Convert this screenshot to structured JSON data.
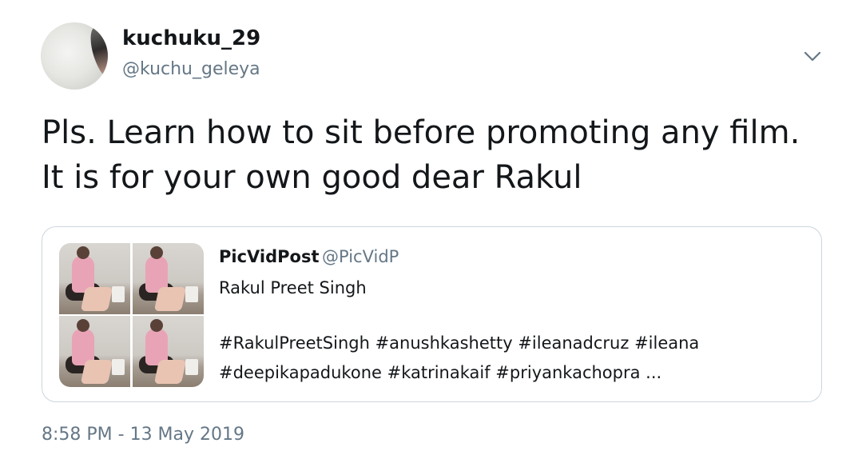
{
  "tweet": {
    "display_name": "kuchuku_29",
    "handle": "@kuchu_geleya",
    "text": "Pls. Learn how to sit before promoting any film. It is for your own good dear Rakul",
    "timestamp": "8:58 PM - 13 May 2019",
    "menu_icon": "chevron-down-icon"
  },
  "quoted_tweet": {
    "display_name": "PicVidPost",
    "handle": "@PicVidP",
    "line1": "Rakul Preet Singh",
    "line2": "#RakulPreetSingh #anushkashetty #ileanadcruz #ileana",
    "line3": "#deepikapadukone #katrinakaif #priyankachopra ..."
  },
  "colors": {
    "text": "#14171a",
    "secondary": "#657786",
    "border": "#ccd6dd"
  }
}
